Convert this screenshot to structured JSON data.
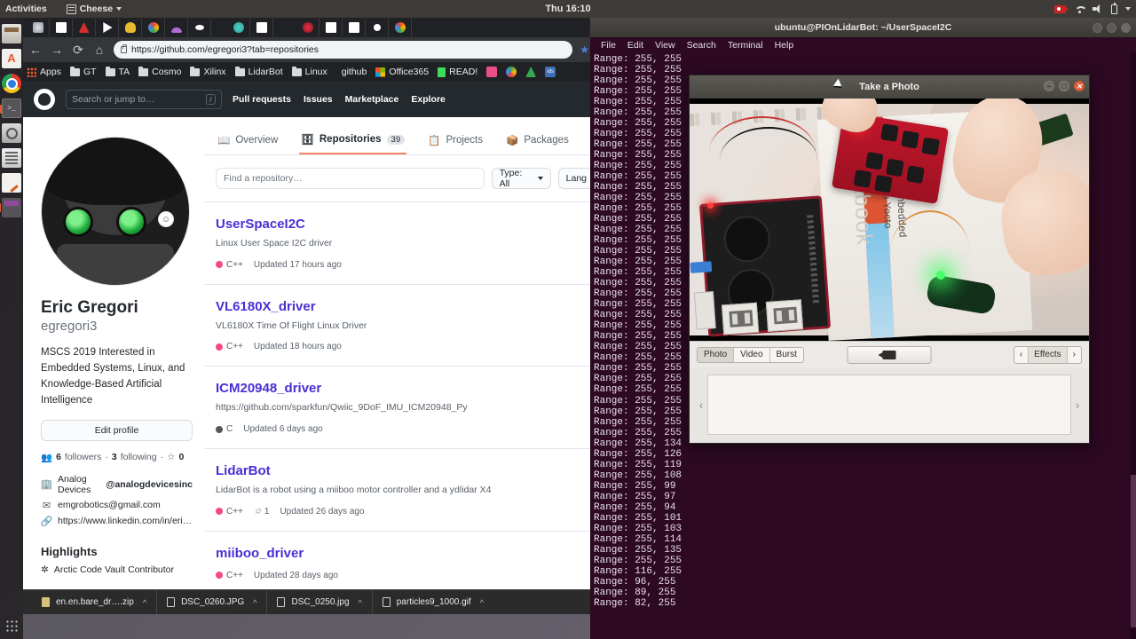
{
  "desktop": {
    "topbar": {
      "activities": "Activities",
      "app_menu": "Cheese",
      "clock": "Thu 16:10",
      "tray_icons": [
        "screen-record-icon",
        "wifi-icon",
        "volume-icon",
        "battery-icon",
        "system-menu-chevron-icon"
      ]
    },
    "dock": {
      "items": [
        {
          "name": "files",
          "icon": "files-icon"
        },
        {
          "name": "amazon",
          "icon": "amazon-icon"
        },
        {
          "name": "chrome",
          "icon": "chrome-icon"
        },
        {
          "name": "terminal",
          "icon": "terminal-icon"
        },
        {
          "name": "cheese",
          "icon": "camera-icon"
        },
        {
          "name": "calculator",
          "icon": "calculator-icon"
        },
        {
          "name": "text-editor",
          "icon": "text-editor-icon"
        },
        {
          "name": "app",
          "icon": "app-icon"
        }
      ],
      "show_applications": "show-applications-grid-icon"
    }
  },
  "browser": {
    "nav": {
      "back": "←",
      "forward": "→",
      "reload": "⟳",
      "home": "⌂"
    },
    "url": "https://github.com/egregori3?tab=repositories",
    "url_host": "https://github.com",
    "url_path": "/egregori3?tab=repositories",
    "bookmarks": [
      {
        "label": "Apps",
        "icon": "apps-grid-icon"
      },
      {
        "label": "GT",
        "icon": "folder-icon"
      },
      {
        "label": "TA",
        "icon": "folder-icon"
      },
      {
        "label": "Cosmo",
        "icon": "folder-icon"
      },
      {
        "label": "Xilinx",
        "icon": "folder-icon"
      },
      {
        "label": "LidarBot",
        "icon": "folder-icon"
      },
      {
        "label": "Linux",
        "icon": "folder-icon"
      },
      {
        "label": "github",
        "icon": "none"
      },
      {
        "label": "Office365",
        "icon": "microsoft-icon"
      },
      {
        "label": "READ!",
        "icon": "green-doc-icon"
      }
    ]
  },
  "github": {
    "header": {
      "logo": "github-mark-icon",
      "search_placeholder": "Search or jump to…",
      "search_shortcut": "/",
      "nav": [
        "Pull requests",
        "Issues",
        "Marketplace",
        "Explore"
      ]
    },
    "profile": {
      "avatar": "robot-avatar",
      "name": "Eric Gregori",
      "handle": "egregori3",
      "bio": "MSCS 2019 Interested in Embedded Systems, Linux, and Knowledge-Based Artificial Intelligence",
      "edit_button": "Edit profile",
      "followers_count": "6",
      "followers_label": "followers",
      "following_count": "3",
      "following_label": "following",
      "stars_count": "0",
      "separator": "·",
      "company": "Analog Devices",
      "company_handle": "@analogdevicesinc",
      "email": "emgrobotics@gmail.com",
      "link": "https://www.linkedin.com/in/eric-gr…",
      "highlights_title": "Highlights",
      "highlight_item": "Arctic Code Vault Contributor"
    },
    "tabs": [
      {
        "label": "Overview",
        "icon": "book-icon",
        "count": null,
        "active": false
      },
      {
        "label": "Repositories",
        "icon": "repo-icon",
        "count": "39",
        "active": true
      },
      {
        "label": "Projects",
        "icon": "project-icon",
        "count": null,
        "active": false
      },
      {
        "label": "Packages",
        "icon": "package-icon",
        "count": null,
        "active": false
      }
    ],
    "filters": {
      "search_placeholder": "Find a repository…",
      "type_label": "Type: All",
      "language_label": "Lang"
    },
    "repositories": [
      {
        "name": "UserSpaceI2C",
        "description": "Linux User Space I2C driver",
        "language": "C++",
        "lang_color": "#f34b7d",
        "stars": null,
        "updated": "Updated 17 hours ago"
      },
      {
        "name": "VL6180X_driver",
        "description": "VL6180X Time Of Flight Linux Driver",
        "language": "C++",
        "lang_color": "#f34b7d",
        "stars": null,
        "updated": "Updated 18 hours ago"
      },
      {
        "name": "ICM20948_driver",
        "description": "https://github.com/sparkfun/Qwiic_9DoF_IMU_ICM20948_Py",
        "language": "C",
        "lang_color": "#555555",
        "stars": null,
        "updated": "Updated 6 days ago"
      },
      {
        "name": "LidarBot",
        "description": "LidarBot is a robot using a miiboo motor controller and a ydlidar X4",
        "language": "C++",
        "lang_color": "#f34b7d",
        "stars": "1",
        "updated": "Updated 26 days ago"
      },
      {
        "name": "miiboo_driver",
        "description": "",
        "language": "C++",
        "lang_color": "#f34b7d",
        "stars": null,
        "updated": "Updated 28 days ago"
      }
    ]
  },
  "downloads": [
    {
      "filename": "en.en.bare_dr….zip",
      "icon": "zip-file-icon"
    },
    {
      "filename": "DSC_0260.JPG",
      "icon": "image-file-icon"
    },
    {
      "filename": "DSC_0250.jpg",
      "icon": "image-file-icon"
    },
    {
      "filename": "particles9_1000.gif",
      "icon": "image-file-icon"
    }
  ],
  "terminal": {
    "title": "ubuntu@PIOnLidarBot: ~/UserSpaceI2C",
    "menu": [
      "File",
      "Edit",
      "View",
      "Search",
      "Terminal",
      "Help"
    ],
    "lines": [
      "Range: 255, 255",
      "Range: 255, 255",
      "Range: 255, 255",
      "Range: 255, 255",
      "Range: 255, 255",
      "Range: 255, 255",
      "Range: 255, 255",
      "Range: 255, 255",
      "Range: 255, 255",
      "Range: 255, 255",
      "Range: 255, 255",
      "Range: 255, 255",
      "Range: 255, 255",
      "Range: 255, 255",
      "Range: 255, 255",
      "Range: 255, 255",
      "Range: 255, 255",
      "Range: 255, 255",
      "Range: 255, 255",
      "Range: 255, 255",
      "Range: 255, 255",
      "Range: 255, 255",
      "Range: 255, 255",
      "Range: 255, 255",
      "Range: 255, 255",
      "Range: 255, 255",
      "Range: 255, 255",
      "Range: 255, 255",
      "Range: 255, 255",
      "Range: 255, 255",
      "Range: 255, 255",
      "Range: 255, 255",
      "Range: 255, 255",
      "Range: 255, 255",
      "Range: 255, 255",
      "Range: 255, 255",
      "Range: 255, 134",
      "Range: 255, 126",
      "Range: 255, 119",
      "Range: 255, 108",
      "Range: 255, 99",
      "Range: 255, 97",
      "Range: 255, 94",
      "Range: 255, 101",
      "Range: 255, 103",
      "Range: 255, 114",
      "Range: 255, 135",
      "Range: 255, 255",
      "Range: 116, 255",
      "Range: 96, 255",
      "Range: 89, 255",
      "Range: 82, 255"
    ],
    "window_buttons": [
      "minimize",
      "maximize",
      "close"
    ]
  },
  "cheese": {
    "title": "Take a Photo",
    "window_buttons": [
      "minimize-icon",
      "maximize-icon",
      "close-icon"
    ],
    "modes": [
      {
        "label": "Photo",
        "active": true
      },
      {
        "label": "Video",
        "active": false
      },
      {
        "label": "Burst",
        "active": false
      }
    ],
    "capture_button": "camera-capture-icon",
    "effects": {
      "prev": "‹",
      "label": "Effects",
      "next": "›"
    },
    "gallery": {
      "prev": "‹",
      "next": "›"
    },
    "viewfinder": {
      "scene": "webcam-live-preview",
      "notebook_text": "Designing Embedded Systems with Yocto",
      "notebook_title": "Workbook"
    }
  }
}
